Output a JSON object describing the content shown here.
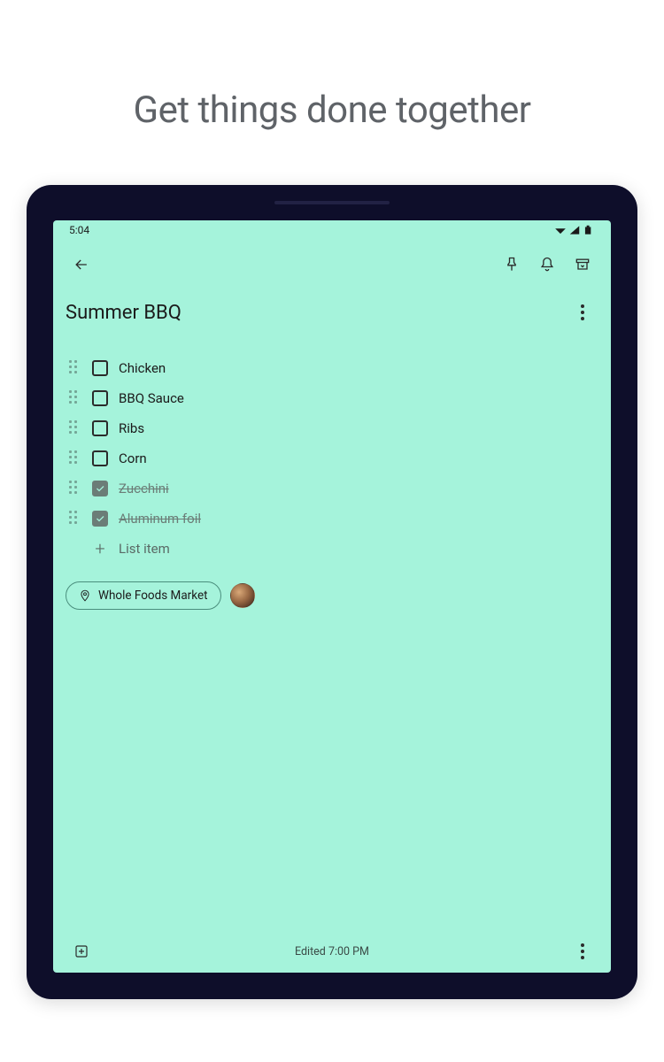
{
  "hero": {
    "title": "Get things done together"
  },
  "status": {
    "time": "5:04"
  },
  "note": {
    "title": "Summer BBQ",
    "items": [
      {
        "label": "Chicken",
        "checked": false
      },
      {
        "label": "BBQ Sauce",
        "checked": false
      },
      {
        "label": "Ribs",
        "checked": false
      },
      {
        "label": "Corn",
        "checked": false
      },
      {
        "label": "Zucchini",
        "checked": true
      },
      {
        "label": "Aluminum foil",
        "checked": true
      }
    ],
    "add_placeholder": "List item",
    "location_chip": "Whole Foods Market",
    "edited": "Edited 7:00 PM"
  }
}
